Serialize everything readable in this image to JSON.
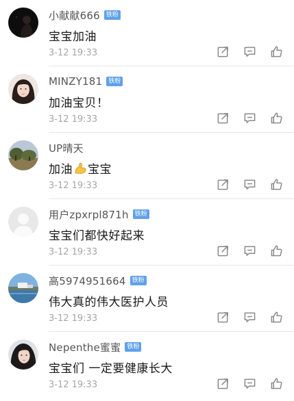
{
  "comments": [
    {
      "username": "小献献666",
      "badge": "铁粉",
      "text": "宝宝加油",
      "time": "3-12 19:33",
      "avatar_icon": "dark-silhouette-avatar"
    },
    {
      "username": "MINZY181",
      "badge": "铁粉",
      "text": "加油宝贝！",
      "time": "3-12 19:33",
      "avatar_icon": "girl-portrait-avatar"
    },
    {
      "username": "UP晴天",
      "badge": "",
      "text_before": "加油",
      "emoji_icon": "flexed-biceps-emoji",
      "text_after": "宝宝",
      "time": "3-12 19:33",
      "avatar_icon": "landscape-trees-avatar"
    },
    {
      "username": "用户zpxrpl871h",
      "badge": "铁粉",
      "text": "宝宝们都快好起来",
      "time": "3-12 19:33",
      "avatar_icon": "default-person-avatar"
    },
    {
      "username": "高5974951664",
      "badge": "铁粉",
      "text": "伟大真的伟大医护人员",
      "time": "3-12 19:33",
      "avatar_icon": "seaside-scenery-avatar"
    },
    {
      "username": "Nepenthe蜜蜜",
      "badge": "铁粉",
      "text": "宝宝们 一定要健康长大",
      "time": "3-12 19:33",
      "avatar_icon": "girl-portrait-avatar"
    }
  ],
  "action_icons": [
    "repost-icon",
    "comment-icon",
    "like-icon"
  ],
  "colors": {
    "badge": "#5fa1ea",
    "timestamp": "#a6a6a6",
    "icon": "#8a8a8a",
    "divider": "#e6e6e6"
  }
}
